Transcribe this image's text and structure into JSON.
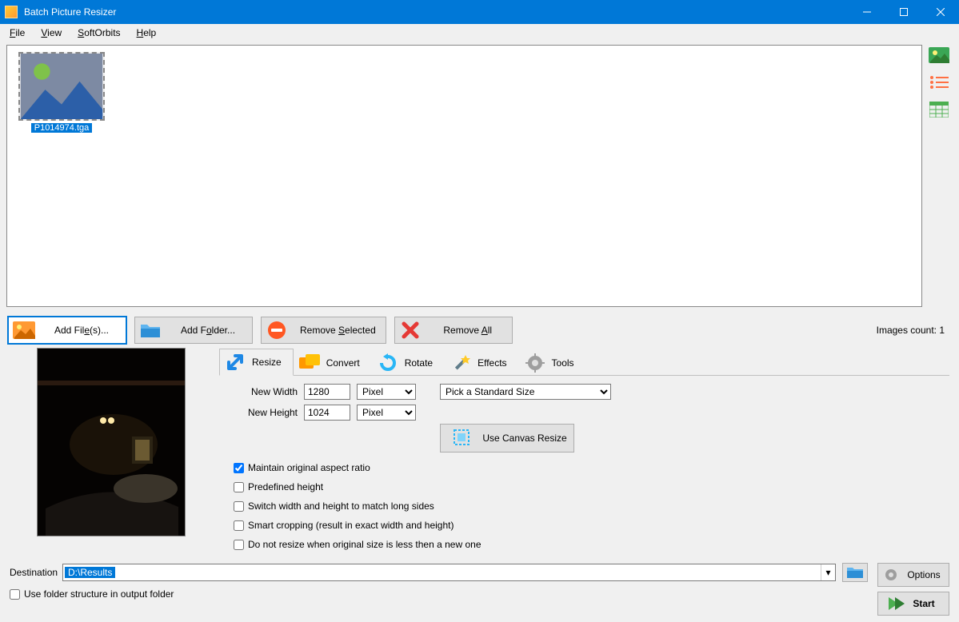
{
  "title": "Batch Picture Resizer",
  "menus": {
    "file": "File",
    "view": "View",
    "softorbits": "SoftOrbits",
    "help": "Help"
  },
  "thumb": {
    "caption": "P1014974.tga"
  },
  "filebar": {
    "add_files": "Add File(s)...",
    "add_folder": "Add Folder...",
    "remove_selected": "Remove Selected",
    "remove_all": "Remove All",
    "images_count_label": "Images count: 1"
  },
  "tabs": {
    "resize": "Resize",
    "convert": "Convert",
    "rotate": "Rotate",
    "effects": "Effects",
    "tools": "Tools"
  },
  "resize": {
    "new_width_label": "New Width",
    "new_height_label": "New Height",
    "width": "1280",
    "height": "1024",
    "unit_width": "Pixel",
    "unit_height": "Pixel",
    "standard_size": "Pick a Standard Size",
    "maintain": "Maintain original aspect ratio",
    "predefined": "Predefined height",
    "switch": "Switch width and height to match long sides",
    "smart": "Smart cropping (result in exact width and height)",
    "noresize": "Do not resize when original size is less then a new one",
    "canvas": "Use Canvas Resize"
  },
  "dest": {
    "label": "Destination",
    "value": "D:\\Results"
  },
  "folder_structure": "Use folder structure in output folder",
  "buttons": {
    "options": "Options",
    "start": "Start"
  }
}
